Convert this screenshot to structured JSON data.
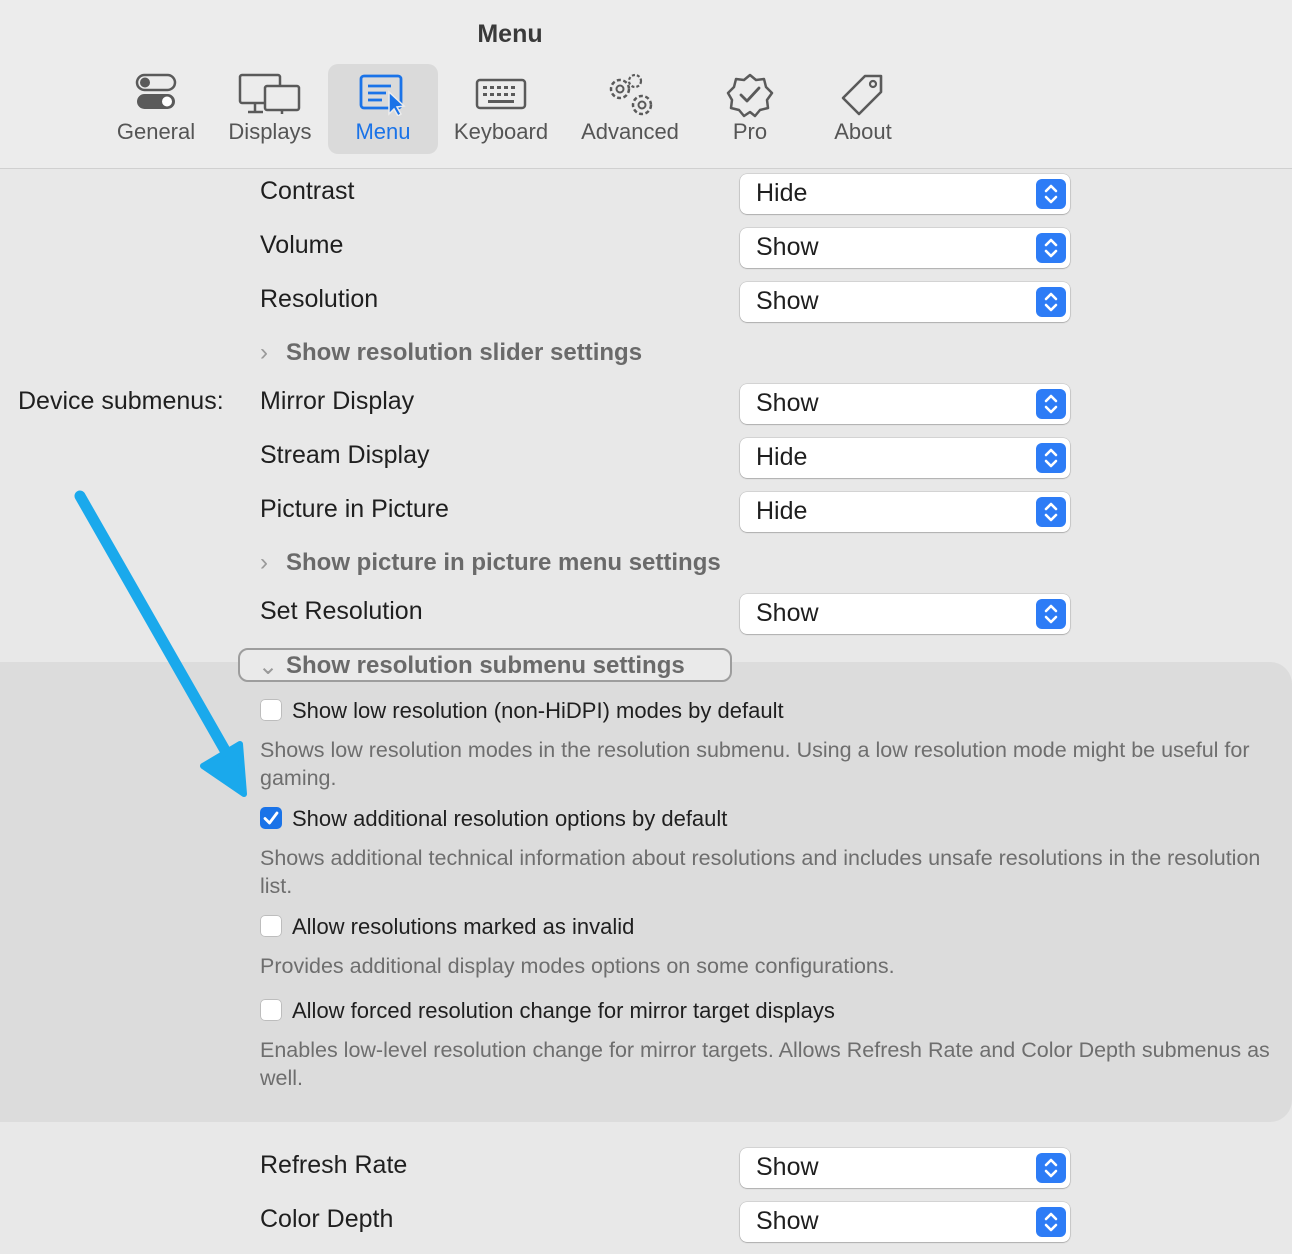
{
  "window": {
    "title": "Menu"
  },
  "tabs": [
    {
      "label": "General",
      "icon": "toggles-icon",
      "active": false
    },
    {
      "label": "Displays",
      "icon": "displays-icon",
      "active": false
    },
    {
      "label": "Menu",
      "icon": "menu-cursor-icon",
      "active": true
    },
    {
      "label": "Keyboard",
      "icon": "keyboard-icon",
      "active": false
    },
    {
      "label": "Advanced",
      "icon": "gears-icon",
      "active": false
    },
    {
      "label": "Pro",
      "icon": "badge-check-icon",
      "active": false
    },
    {
      "label": "About",
      "icon": "tag-icon",
      "active": false
    }
  ],
  "accent_color": "#1a73e8",
  "rows": {
    "contrast": {
      "label": "Contrast",
      "value": "Hide"
    },
    "volume": {
      "label": "Volume",
      "value": "Show"
    },
    "resolution": {
      "label": "Resolution",
      "value": "Show"
    },
    "resolution_slider_disclosure": "Show resolution slider settings",
    "device_submenus_label": "Device submenus:",
    "mirror_display": {
      "label": "Mirror Display",
      "value": "Show"
    },
    "stream_display": {
      "label": "Stream Display",
      "value": "Hide"
    },
    "picture_in_picture": {
      "label": "Picture in Picture",
      "value": "Hide"
    },
    "pip_disclosure": "Show picture in picture menu settings",
    "set_resolution": {
      "label": "Set Resolution",
      "value": "Show"
    },
    "resolution_submenu_disclosure": "Show resolution submenu settings",
    "refresh_rate": {
      "label": "Refresh Rate",
      "value": "Show"
    },
    "color_depth": {
      "label": "Color Depth",
      "value": "Show"
    }
  },
  "submenu_settings": [
    {
      "label": "Show low resolution (non-HiDPI) modes by default",
      "checked": false,
      "description": "Shows low resolution modes in the resolution submenu. Using a low resolution mode might be useful for gaming."
    },
    {
      "label": "Show additional resolution options by default",
      "checked": true,
      "description": "Shows additional technical information about resolutions and includes unsafe resolutions in the resolution list."
    },
    {
      "label": "Allow resolutions marked as invalid",
      "checked": false,
      "description": "Provides additional display modes options on some configurations."
    },
    {
      "label": "Allow forced resolution change for mirror target displays",
      "checked": false,
      "description": "Enables low-level resolution change for mirror targets. Allows Refresh Rate and Color Depth submenus as well."
    }
  ]
}
